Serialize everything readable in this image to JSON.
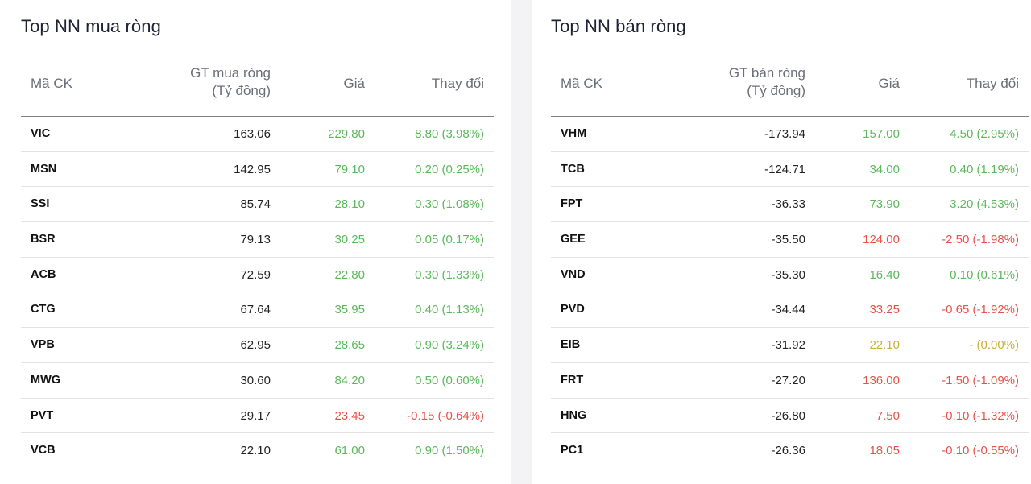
{
  "colors": {
    "up": "#5cb85c",
    "down": "#e5534b",
    "reference": "#c9b13a"
  },
  "buy_panel": {
    "title": "Top NN mua ròng",
    "headers": {
      "code": "Mã CK",
      "value_line1": "GT mua ròng",
      "value_line2": "(Tỷ đồng)",
      "price": "Giá",
      "change": "Thay đổi"
    },
    "rows": [
      {
        "code": "VIC",
        "value": "163.06",
        "price": "229.80",
        "change": "8.80 (3.98%)",
        "trend": "up"
      },
      {
        "code": "MSN",
        "value": "142.95",
        "price": "79.10",
        "change": "0.20 (0.25%)",
        "trend": "up"
      },
      {
        "code": "SSI",
        "value": "85.74",
        "price": "28.10",
        "change": "0.30 (1.08%)",
        "trend": "up"
      },
      {
        "code": "BSR",
        "value": "79.13",
        "price": "30.25",
        "change": "0.05 (0.17%)",
        "trend": "up"
      },
      {
        "code": "ACB",
        "value": "72.59",
        "price": "22.80",
        "change": "0.30 (1.33%)",
        "trend": "up"
      },
      {
        "code": "CTG",
        "value": "67.64",
        "price": "35.95",
        "change": "0.40 (1.13%)",
        "trend": "up"
      },
      {
        "code": "VPB",
        "value": "62.95",
        "price": "28.65",
        "change": "0.90 (3.24%)",
        "trend": "up"
      },
      {
        "code": "MWG",
        "value": "30.60",
        "price": "84.20",
        "change": "0.50 (0.60%)",
        "trend": "up"
      },
      {
        "code": "PVT",
        "value": "29.17",
        "price": "23.45",
        "change": "-0.15 (-0.64%)",
        "trend": "down"
      },
      {
        "code": "VCB",
        "value": "22.10",
        "price": "61.00",
        "change": "0.90 (1.50%)",
        "trend": "up"
      }
    ]
  },
  "sell_panel": {
    "title": "Top NN bán ròng",
    "headers": {
      "code": "Mã CK",
      "value_line1": "GT bán ròng",
      "value_line2": "(Tỷ đồng)",
      "price": "Giá",
      "change": "Thay đổi"
    },
    "rows": [
      {
        "code": "VHM",
        "value": "-173.94",
        "price": "157.00",
        "change": "4.50 (2.95%)",
        "trend": "up"
      },
      {
        "code": "TCB",
        "value": "-124.71",
        "price": "34.00",
        "change": "0.40 (1.19%)",
        "trend": "up"
      },
      {
        "code": "FPT",
        "value": "-36.33",
        "price": "73.90",
        "change": "3.20 (4.53%)",
        "trend": "up"
      },
      {
        "code": "GEE",
        "value": "-35.50",
        "price": "124.00",
        "change": "-2.50 (-1.98%)",
        "trend": "down"
      },
      {
        "code": "VND",
        "value": "-35.30",
        "price": "16.40",
        "change": "0.10 (0.61%)",
        "trend": "up"
      },
      {
        "code": "PVD",
        "value": "-34.44",
        "price": "33.25",
        "change": "-0.65 (-1.92%)",
        "trend": "down"
      },
      {
        "code": "EIB",
        "value": "-31.92",
        "price": "22.10",
        "change": "- (0.00%)",
        "trend": "ref"
      },
      {
        "code": "FRT",
        "value": "-27.20",
        "price": "136.00",
        "change": "-1.50 (-1.09%)",
        "trend": "down"
      },
      {
        "code": "HNG",
        "value": "-26.80",
        "price": "7.50",
        "change": "-0.10 (-1.32%)",
        "trend": "down"
      },
      {
        "code": "PC1",
        "value": "-26.36",
        "price": "18.05",
        "change": "-0.10 (-0.55%)",
        "trend": "down"
      }
    ]
  }
}
